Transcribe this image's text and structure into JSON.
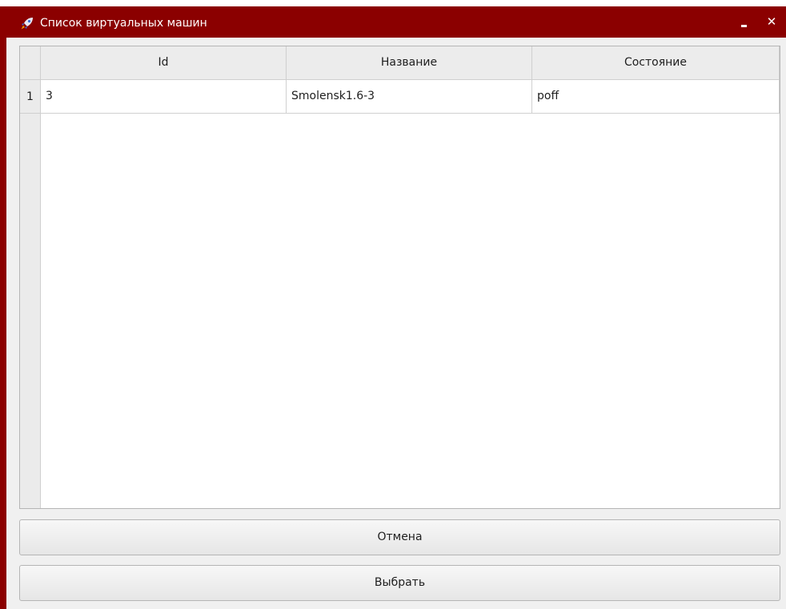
{
  "window": {
    "title": "Список виртуальных машин",
    "app_icon": "rocket-icon",
    "controls": {
      "minimize_icon": "minimize-icon",
      "close_icon": "close-icon",
      "close_glyph": "✕"
    }
  },
  "table": {
    "columns": [
      "Id",
      "Название",
      "Состояние"
    ],
    "rows": [
      {
        "row_number": "1",
        "cells": [
          "3",
          "Smolensk1.6-3",
          "poff"
        ]
      }
    ]
  },
  "buttons": {
    "cancel_label": "Отмена",
    "select_label": "Выбрать"
  },
  "colors": {
    "titlebar": "#8b0000",
    "background": "#f0f0f0"
  }
}
